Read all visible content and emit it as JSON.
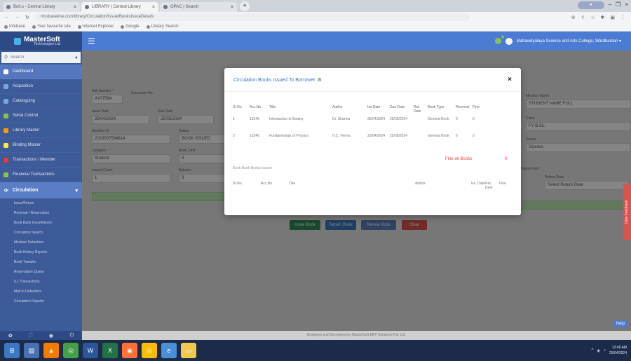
{
  "browser": {
    "tabs": [
      {
        "label": "Bolt.s - Central Library"
      },
      {
        "label": "LIBRARY | Central Library"
      },
      {
        "label": "OPAC | Search"
      }
    ],
    "new_tab": "+",
    "url": "mssbaseline.com/library/Circulation/Issue/BooksIssueDetails",
    "bookmarks": [
      "Infobase",
      "Your favourite site",
      "Internet Explorer",
      "Google",
      "Library Search"
    ]
  },
  "app": {
    "brand": "MasterSoft",
    "brand_sub": "Technologies Ltd.",
    "search_placeholder": "Search",
    "college": "Mahavidyalaya Science and Arts College, Wardhaman ▾",
    "notif_count": "3",
    "sidebar": {
      "items": [
        {
          "label": "Dashboard",
          "icon": "home-icon",
          "active": true,
          "color": "#ffffff"
        },
        {
          "label": "Acquisition",
          "icon": "chart-icon",
          "color": "#7ea4e0"
        },
        {
          "label": "Cataloguing",
          "icon": "globe-icon",
          "color": "#7ea4e0"
        },
        {
          "label": "Serial Control",
          "icon": "gears-icon",
          "color": "#8bc34a"
        },
        {
          "label": "Library Master",
          "icon": "puzzle-icon",
          "color": "#ff9800"
        },
        {
          "label": "Binding Master",
          "icon": "tag-icon",
          "color": "#ffeb3b"
        },
        {
          "label": "Transactions / Member",
          "icon": "users-icon",
          "color": "#e53935"
        },
        {
          "label": "Financial Transactions",
          "icon": "book-icon",
          "color": "#8bc34a"
        }
      ],
      "section": "Circulation",
      "sub_items": [
        "Issue/Return",
        "Renewal / Reservation",
        "Book Bank Issue/Return",
        "Circulation Search",
        "Member Defaulters",
        "Book History Reports",
        "Book Transfer",
        "Reservation Queue",
        "ILL Transactions",
        "Mail to Defaulters",
        "Circulation Reports"
      ]
    },
    "footer_icons": [
      "settings-icon",
      "expand-icon",
      "eye-icon",
      "power-icon"
    ]
  },
  "form": {
    "roll_no_label": "Roll Number *",
    "roll_no_value": "AY07584",
    "accession_label": "Accession No.",
    "issue_date_label": "Issue Date",
    "issue_date_value": "25/04/2024",
    "due_date_label": "Due Date",
    "due_date_value": "25/05/2024",
    "member_label": "Member Id",
    "member_value": "2023007584614",
    "status_label": "Status",
    "status_value": "BOOK ISSUED",
    "category_label": "Category",
    "category_value": "Student",
    "limit_label": "Book Limit",
    "limit_value": "4",
    "issued_label": "Issued Count",
    "issued_value": "1",
    "balance_label": "Balance",
    "balance_value": "3",
    "right_member_label": "Member Name",
    "right_member_value": "STUDENT NAME FULL",
    "right_class_label": "Class",
    "right_class_value": "FY B.Sc.",
    "right_group_label": "Group",
    "right_group_value": "Science",
    "right_section_label": "Department",
    "right_return_label": "Return Date",
    "right_return_value": "Select Return Date",
    "buttons": [
      "Issue Book",
      "Return Book",
      "Renew Book",
      "Clear"
    ],
    "button_colors": [
      "#2e8b57",
      "#3b78c2",
      "#5b7fbf",
      "#d9534f"
    ]
  },
  "modal": {
    "title": "Circulation Books Issued To Borrower",
    "gear": "⚙",
    "close": "×",
    "headers": [
      "Sr.No.",
      "Acc.No.",
      "Title",
      "Author",
      "Iss.Date",
      "Due Date",
      "Ret. Date",
      "Book Type",
      "Renewal",
      "Fine"
    ],
    "rows": [
      [
        "1",
        "12345",
        "Introduction to Botany",
        "Dr. Sharma",
        "25/04/2024",
        "25/05/2024",
        "",
        "General Book",
        "0",
        "0"
      ],
      [
        "2",
        "12346",
        "Fundamentals of Physics",
        "H.C. Verma",
        "25/04/2024",
        "25/05/2024",
        "",
        "General Book",
        "0",
        "0"
      ]
    ],
    "fine_label": "Fine on Books",
    "fine_value": "0",
    "section2": "Book Bank Books Issued",
    "headers2": [
      "Sr.No.",
      "Acc.No.",
      "Title",
      "Author",
      "Iss. Date",
      "Ret. Date",
      "Fine"
    ]
  },
  "footer": "Designed and Developed by MasterSoft ERP Solutions Pvt. Ltd.",
  "help": "Help",
  "feedback": "Give Feedback",
  "taskbar": {
    "icons": [
      "start-icon",
      "files-icon",
      "vlc-icon",
      "chrome-icon",
      "word-icon",
      "excel-icon",
      "firefox-icon",
      "chrome-alt-icon",
      "explorer-icon",
      "folder-icon"
    ],
    "time": "12:48 AM",
    "date": "25/04/2024"
  }
}
